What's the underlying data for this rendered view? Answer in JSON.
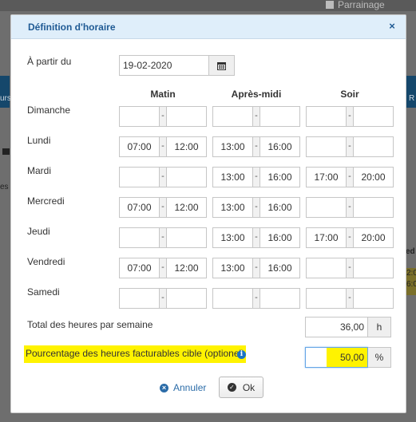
{
  "background": {
    "top_link": "Parrainage",
    "left_fragment": "urs",
    "right_fragment": "R",
    "left_es": "es",
    "right_ed": "ed",
    "right_values": [
      "2:0",
      "6:0"
    ]
  },
  "dialog": {
    "title": "Définition d'horaire",
    "close_glyph": "×",
    "start_label": "À partir du",
    "start_date": "19-02-2020",
    "columns": [
      "Matin",
      "Après-midi",
      "Soir"
    ],
    "separator": "-",
    "days": [
      {
        "label": "Dimanche",
        "slots": [
          [
            "",
            ""
          ],
          [
            "",
            ""
          ],
          [
            "",
            ""
          ]
        ]
      },
      {
        "label": "Lundi",
        "slots": [
          [
            "07:00",
            "12:00"
          ],
          [
            "13:00",
            "16:00"
          ],
          [
            "",
            ""
          ]
        ]
      },
      {
        "label": "Mardi",
        "slots": [
          [
            "",
            ""
          ],
          [
            "13:00",
            "16:00"
          ],
          [
            "17:00",
            "20:00"
          ]
        ]
      },
      {
        "label": "Mercredi",
        "slots": [
          [
            "07:00",
            "12:00"
          ],
          [
            "13:00",
            "16:00"
          ],
          [
            "",
            ""
          ]
        ]
      },
      {
        "label": "Jeudi",
        "slots": [
          [
            "",
            ""
          ],
          [
            "13:00",
            "16:00"
          ],
          [
            "17:00",
            "20:00"
          ]
        ]
      },
      {
        "label": "Vendredi",
        "slots": [
          [
            "07:00",
            "12:00"
          ],
          [
            "13:00",
            "16:00"
          ],
          [
            "",
            ""
          ]
        ]
      },
      {
        "label": "Samedi",
        "slots": [
          [
            "",
            ""
          ],
          [
            "",
            ""
          ],
          [
            "",
            ""
          ]
        ]
      }
    ],
    "total_label": "Total des heures par semaine",
    "total_value": "36,00",
    "total_unit": "h",
    "percent_label": "Pourcentage des heures facturables cible (optionel)",
    "percent_value": "50,00",
    "percent_unit": "%",
    "cancel_label": "Annuler",
    "ok_label": "Ok"
  },
  "colors": {
    "header_bg": "#dfeefa",
    "title": "#1f5a94",
    "highlight": "#fff300",
    "link": "#2b6ca8"
  }
}
